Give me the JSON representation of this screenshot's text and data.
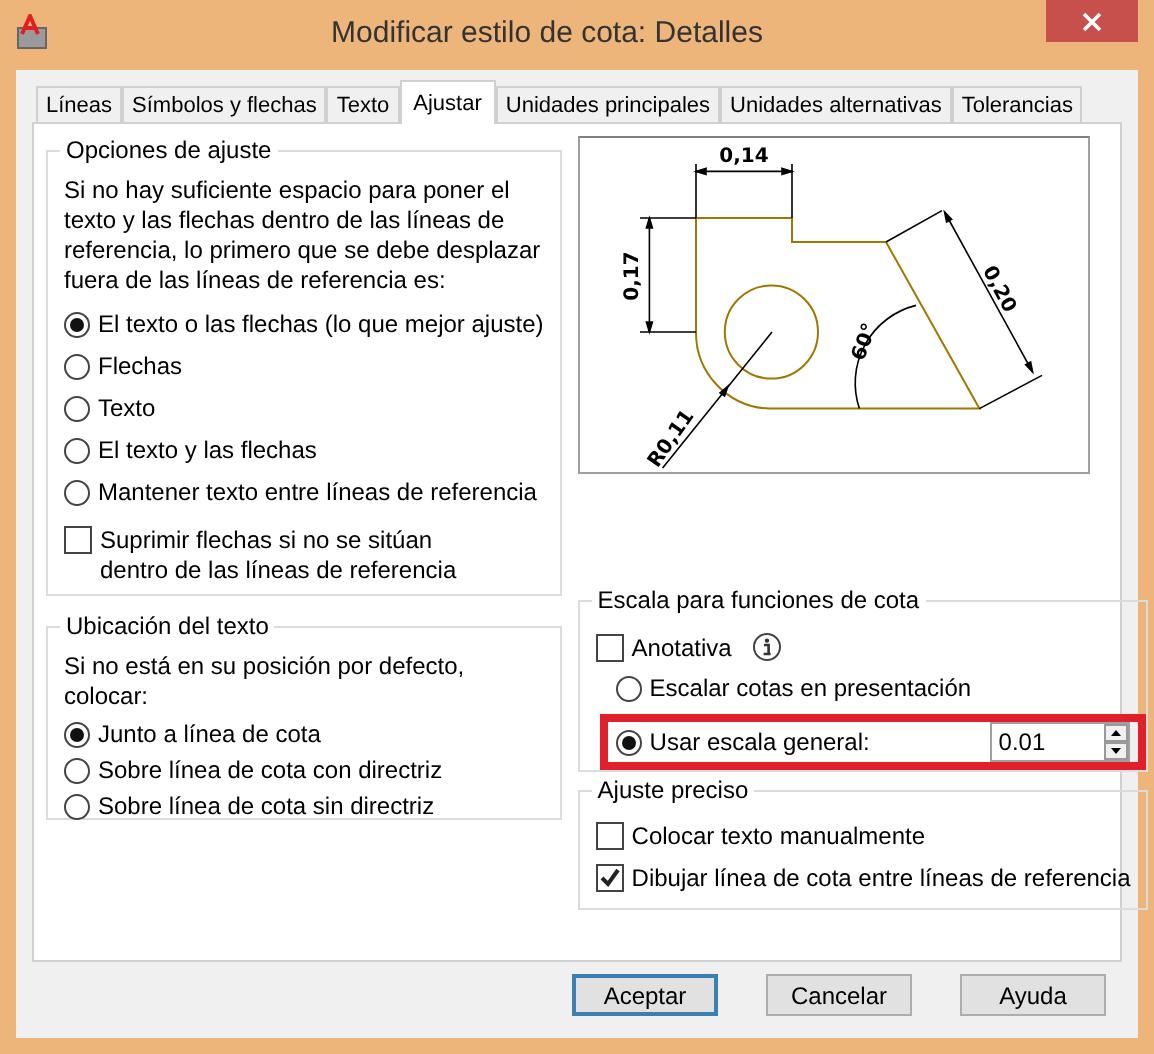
{
  "window": {
    "title": "Modificar estilo de cota: Detalles"
  },
  "tabs": [
    {
      "label": "Líneas",
      "selected": false
    },
    {
      "label": "Símbolos y flechas",
      "selected": false
    },
    {
      "label": "Texto",
      "selected": false
    },
    {
      "label": "Ajustar",
      "selected": true
    },
    {
      "label": "Unidades principales",
      "selected": false
    },
    {
      "label": "Unidades alternativas",
      "selected": false
    },
    {
      "label": "Tolerancias",
      "selected": false
    }
  ],
  "fit_options": {
    "title": "Opciones de ajuste",
    "description": "Si no hay suficiente espacio para poner el texto y las flechas dentro de las líneas de referencia, lo primero que se debe desplazar fuera de las líneas de referencia es:",
    "options": [
      {
        "label": "El texto o las flechas (lo que mejor ajuste)",
        "selected": true
      },
      {
        "label": "Flechas",
        "selected": false
      },
      {
        "label": "Texto",
        "selected": false
      },
      {
        "label": "El texto y las flechas",
        "selected": false
      },
      {
        "label": "Mantener texto entre líneas de referencia",
        "selected": false
      }
    ],
    "suppress": {
      "label": "Suprimir flechas si no se sitúan dentro de las líneas de referencia",
      "checked": false
    }
  },
  "text_placement": {
    "title": "Ubicación del texto",
    "description": "Si no está en su posición por defecto, colocar:",
    "options": [
      {
        "label": "Junto a línea de cota",
        "selected": true
      },
      {
        "label": "Sobre línea de cota con directriz",
        "selected": false
      },
      {
        "label": "Sobre línea de cota sin directriz",
        "selected": false
      }
    ]
  },
  "preview": {
    "labels": [
      "0,14",
      "0,17",
      "0,20",
      "60°",
      "R0,11"
    ]
  },
  "scale": {
    "title": "Escala para funciones de cota",
    "annotative": {
      "label": "Anotativa",
      "checked": false
    },
    "options": [
      {
        "kind": "plain",
        "label": "Escalar cotas en presentación",
        "selected": false
      },
      {
        "kind": "with_value",
        "label": "Usar escala general:",
        "selected": true,
        "value": "0.01",
        "highlighted": true
      }
    ]
  },
  "fine_tuning": {
    "title": "Ajuste preciso",
    "options": [
      {
        "label": "Colocar texto manualmente",
        "checked": false
      },
      {
        "label": "Dibujar línea de cota entre líneas de referencia",
        "checked": true
      }
    ]
  },
  "buttons": [
    {
      "label": "Aceptar",
      "default": true
    },
    {
      "label": "Cancelar",
      "default": false
    },
    {
      "label": "Ayuda",
      "default": false
    }
  ]
}
